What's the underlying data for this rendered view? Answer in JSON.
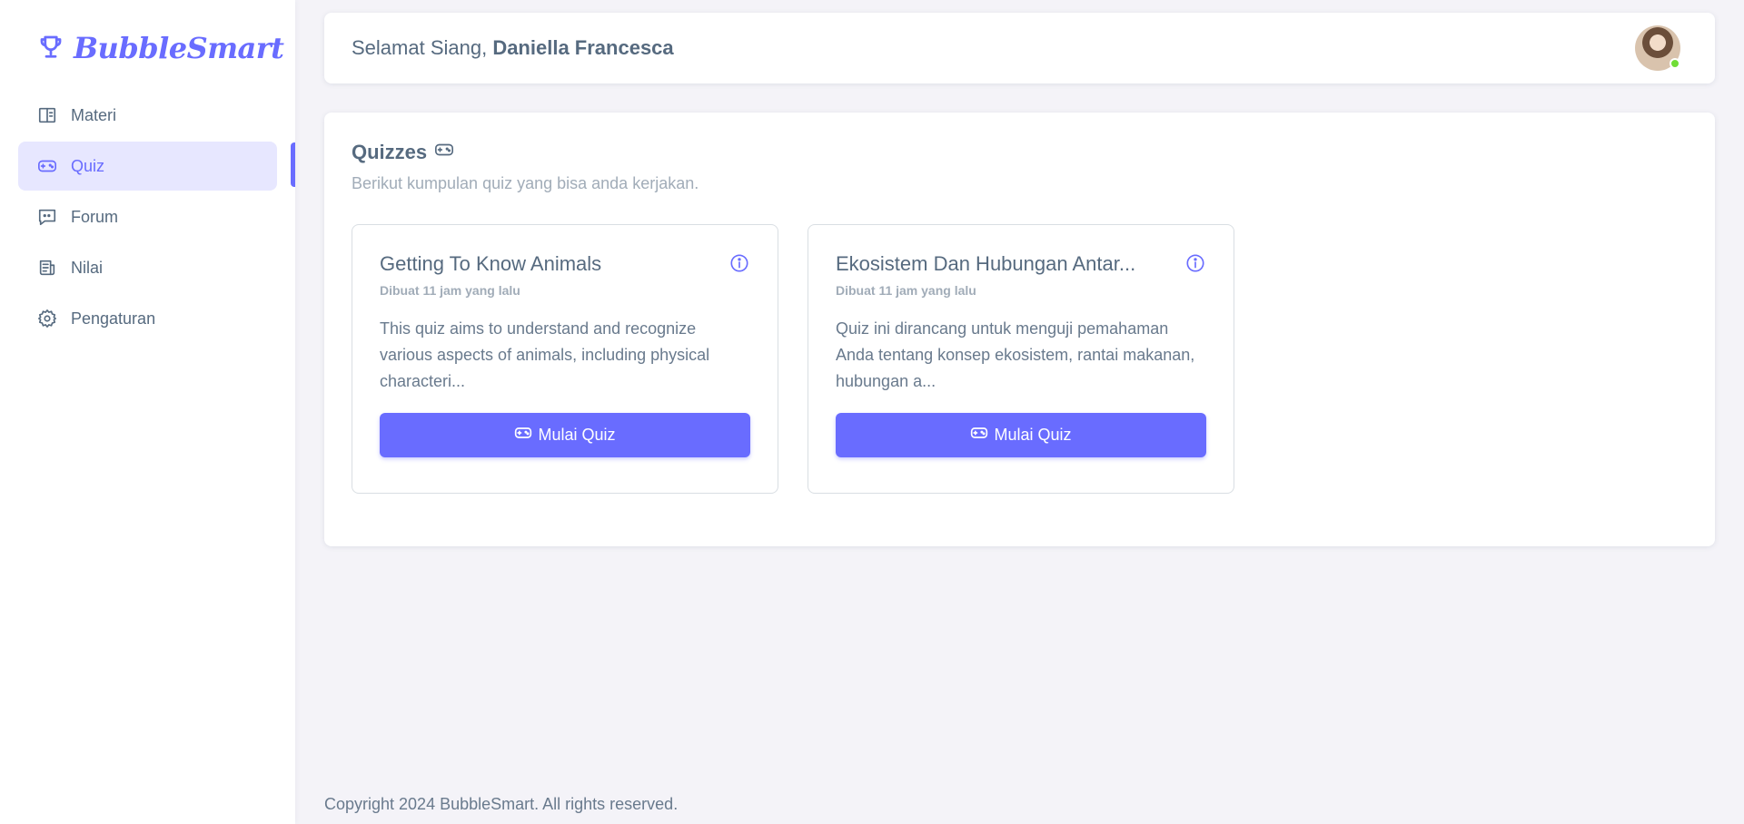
{
  "brand": {
    "name": "BubbleSmart",
    "color": "#696cff",
    "icon": "trophy-icon"
  },
  "sidebar": {
    "items": [
      {
        "label": "Materi",
        "icon": "book-icon",
        "active": false
      },
      {
        "label": "Quiz",
        "icon": "gamepad-icon",
        "active": true
      },
      {
        "label": "Forum",
        "icon": "chat-icon",
        "active": false
      },
      {
        "label": "Nilai",
        "icon": "report-icon",
        "active": false
      },
      {
        "label": "Pengaturan",
        "icon": "gear-icon",
        "active": false
      }
    ]
  },
  "navbar": {
    "greeting_prefix": "Selamat Siang, ",
    "user_name": "Daniella Francesca",
    "avatar_status": "online"
  },
  "main": {
    "title": "Quizzes",
    "subtitle": "Berikut kumpulan quiz yang bisa anda kerjakan.",
    "quizzes": [
      {
        "title": "Getting To Know Animals",
        "meta": "Dibuat 11 jam yang lalu",
        "description": "This quiz aims to understand and recognize various aspects of animals, including physical characteri...",
        "button_label": "Mulai Quiz"
      },
      {
        "title": "Ekosistem Dan Hubungan Antar...",
        "meta": "Dibuat 11 jam yang lalu",
        "description": "Quiz ini dirancang untuk menguji pemahaman Anda tentang konsep ekosistem, rantai makanan, hubungan a...",
        "button_label": "Mulai Quiz"
      }
    ]
  },
  "footer": {
    "text": "Copyright 2024 BubbleSmart. All rights reserved."
  },
  "colors": {
    "accent": "#696cff",
    "accent_light": "#e7e7ff",
    "status_online": "#71dd37"
  }
}
